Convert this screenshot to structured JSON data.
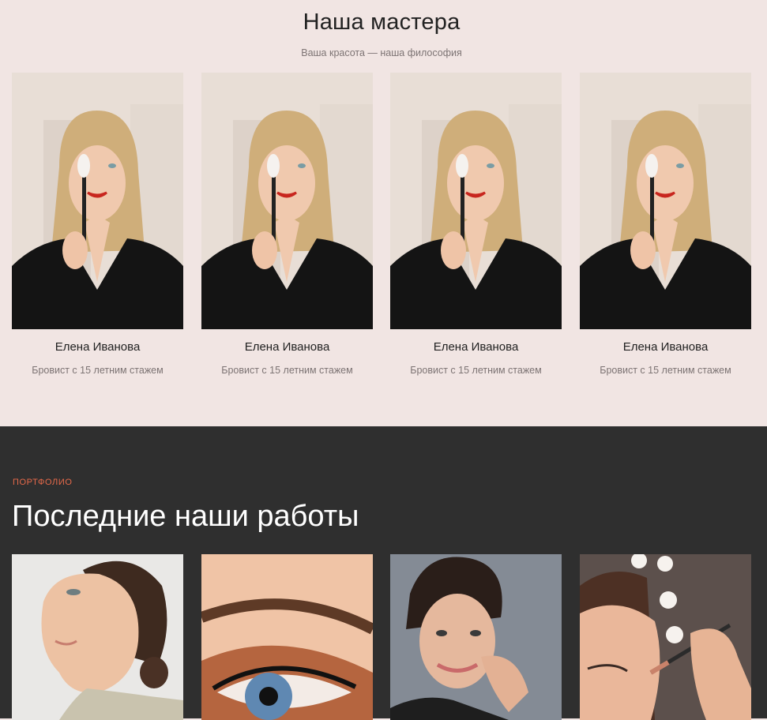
{
  "masters": {
    "title": "Наша мастера",
    "subtitle": "Ваша красота — наша философия",
    "cards": [
      {
        "name": "Елена Иванова",
        "role": "Бровист с 15 летним стажем"
      },
      {
        "name": "Елена Иванова",
        "role": "Бровист с 15 летним стажем"
      },
      {
        "name": "Елена Иванова",
        "role": "Бровист с 15 летним стажем"
      },
      {
        "name": "Елена Иванова",
        "role": "Бровист с 15 летним стажем"
      }
    ]
  },
  "portfolio": {
    "eyebrow": "ПОРТФОЛИО",
    "title": "Последние наши работы"
  },
  "colors": {
    "light_bg": "#f1e5e3",
    "dark_bg": "#2f2f2f",
    "accent": "#e86a4a"
  }
}
